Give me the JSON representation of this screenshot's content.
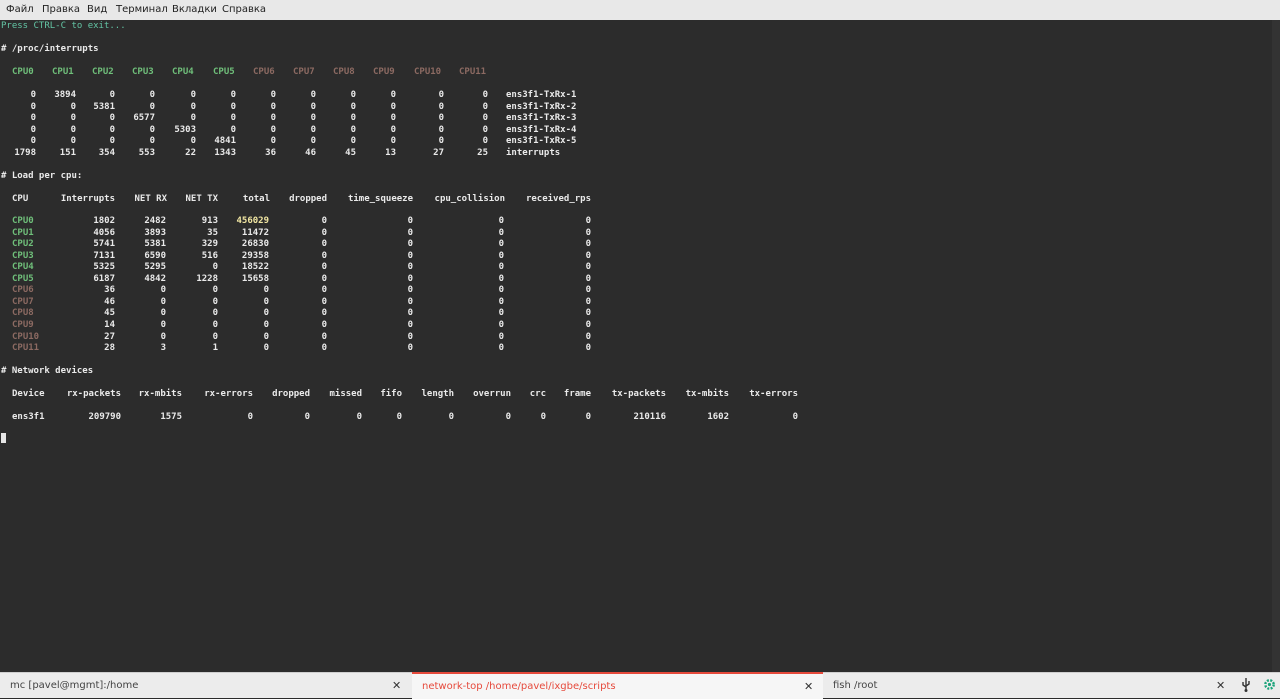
{
  "menubar": {
    "items": [
      "Файл",
      "Правка",
      "Вид",
      "Терминал",
      "Вкладки",
      "Справка"
    ]
  },
  "terminal": {
    "hint": "Press CTRL-C to exit...",
    "interrupts": {
      "heading": "# /proc/interrupts",
      "cpus": [
        "CPU0",
        "CPU1",
        "CPU2",
        "CPU3",
        "CPU4",
        "CPU5",
        "CPU6",
        "CPU7",
        "CPU8",
        "CPU9",
        "CPU10",
        "CPU11"
      ],
      "active_cpus": 6,
      "rows": [
        {
          "values": [
            "0",
            "3894",
            "0",
            "0",
            "0",
            "0",
            "0",
            "0",
            "0",
            "0",
            "0",
            "0"
          ],
          "name": "ens3f1-TxRx-1"
        },
        {
          "values": [
            "0",
            "0",
            "5381",
            "0",
            "0",
            "0",
            "0",
            "0",
            "0",
            "0",
            "0",
            "0"
          ],
          "name": "ens3f1-TxRx-2"
        },
        {
          "values": [
            "0",
            "0",
            "0",
            "6577",
            "0",
            "0",
            "0",
            "0",
            "0",
            "0",
            "0",
            "0"
          ],
          "name": "ens3f1-TxRx-3"
        },
        {
          "values": [
            "0",
            "0",
            "0",
            "0",
            "5303",
            "0",
            "0",
            "0",
            "0",
            "0",
            "0",
            "0"
          ],
          "name": "ens3f1-TxRx-4"
        },
        {
          "values": [
            "0",
            "0",
            "0",
            "0",
            "0",
            "4841",
            "0",
            "0",
            "0",
            "0",
            "0",
            "0"
          ],
          "name": "ens3f1-TxRx-5"
        },
        {
          "values": [
            "1798",
            "151",
            "354",
            "553",
            "22",
            "1343",
            "36",
            "46",
            "45",
            "13",
            "27",
            "25"
          ],
          "name": "interrupts"
        }
      ]
    },
    "load": {
      "heading": "# Load per cpu:",
      "headers": [
        "CPU",
        "Interrupts",
        "NET RX",
        "NET TX",
        "total",
        "dropped",
        "time_squeeze",
        "cpu_collision",
        "received_rps"
      ],
      "rows": [
        {
          "cpu": "CPU0",
          "values": [
            "1802",
            "2482",
            "913",
            "456029",
            "0",
            "0",
            "0",
            "0"
          ],
          "highlight": true
        },
        {
          "cpu": "CPU1",
          "values": [
            "4056",
            "3893",
            "35",
            "11472",
            "0",
            "0",
            "0",
            "0"
          ]
        },
        {
          "cpu": "CPU2",
          "values": [
            "5741",
            "5381",
            "329",
            "26830",
            "0",
            "0",
            "0",
            "0"
          ]
        },
        {
          "cpu": "CPU3",
          "values": [
            "7131",
            "6590",
            "516",
            "29358",
            "0",
            "0",
            "0",
            "0"
          ]
        },
        {
          "cpu": "CPU4",
          "values": [
            "5325",
            "5295",
            "0",
            "18522",
            "0",
            "0",
            "0",
            "0"
          ]
        },
        {
          "cpu": "CPU5",
          "values": [
            "6187",
            "4842",
            "1228",
            "15658",
            "0",
            "0",
            "0",
            "0"
          ]
        },
        {
          "cpu": "CPU6",
          "values": [
            "36",
            "0",
            "0",
            "0",
            "0",
            "0",
            "0",
            "0"
          ]
        },
        {
          "cpu": "CPU7",
          "values": [
            "46",
            "0",
            "0",
            "0",
            "0",
            "0",
            "0",
            "0"
          ]
        },
        {
          "cpu": "CPU8",
          "values": [
            "45",
            "0",
            "0",
            "0",
            "0",
            "0",
            "0",
            "0"
          ]
        },
        {
          "cpu": "CPU9",
          "values": [
            "14",
            "0",
            "0",
            "0",
            "0",
            "0",
            "0",
            "0"
          ]
        },
        {
          "cpu": "CPU10",
          "values": [
            "27",
            "0",
            "0",
            "0",
            "0",
            "0",
            "0",
            "0"
          ]
        },
        {
          "cpu": "CPU11",
          "values": [
            "28",
            "3",
            "1",
            "0",
            "0",
            "0",
            "0",
            "0"
          ]
        }
      ]
    },
    "devices": {
      "heading": "# Network devices",
      "headers": [
        "Device",
        "rx-packets",
        "rx-mbits",
        "rx-errors",
        "dropped",
        "missed",
        "fifo",
        "length",
        "overrun",
        "crc",
        "frame",
        "tx-packets",
        "tx-mbits",
        "tx-errors"
      ],
      "rows": [
        {
          "values": [
            "ens3f1",
            "209790",
            "1575",
            "0",
            "0",
            "0",
            "0",
            "0",
            "0",
            "0",
            "0",
            "210116",
            "1602",
            "0"
          ]
        }
      ]
    }
  },
  "tabs": [
    {
      "label": "mc [pavel@mgmt]:/home",
      "active": false
    },
    {
      "label": "network-top /home/pavel/ixgbe/scripts",
      "active": true
    },
    {
      "label": "fish /root",
      "active": false
    }
  ],
  "tray": {
    "close_glyph": "✕",
    "icons": [
      "usb-icon",
      "settings-icon"
    ]
  },
  "colors": {
    "accent": "#e64a3c",
    "cpu_active": "#6fbf7a",
    "cpu_idle": "#8c6a62",
    "highlight": "#f2e7a3",
    "prompt": "#63c4a4"
  }
}
